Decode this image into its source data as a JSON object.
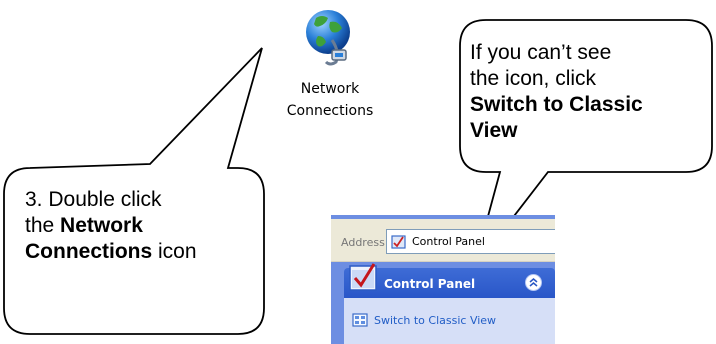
{
  "desktop_icon": {
    "name": "network-connections",
    "label_line1": "Network",
    "label_line2": "Connections",
    "icon": "globe-network-icon"
  },
  "callout_left": {
    "part1": "3. Double click",
    "part2": "the ",
    "bold1": "Network",
    "bold2": "Connections",
    "part3": " icon"
  },
  "callout_right": {
    "line1": "If you can’t see",
    "line2": "the icon, click",
    "bold1": "Switch to Classic",
    "bold2": "View"
  },
  "xp_panel": {
    "address_label": "Address",
    "address_value": "Control Panel",
    "header_title": "Control Panel",
    "link_label": "Switch to Classic View",
    "colors": {
      "panel_bg": "#6d8ee2",
      "header_bg": "#2d5bd0",
      "body_bg": "#d6dff7",
      "link": "#215dc6"
    }
  }
}
